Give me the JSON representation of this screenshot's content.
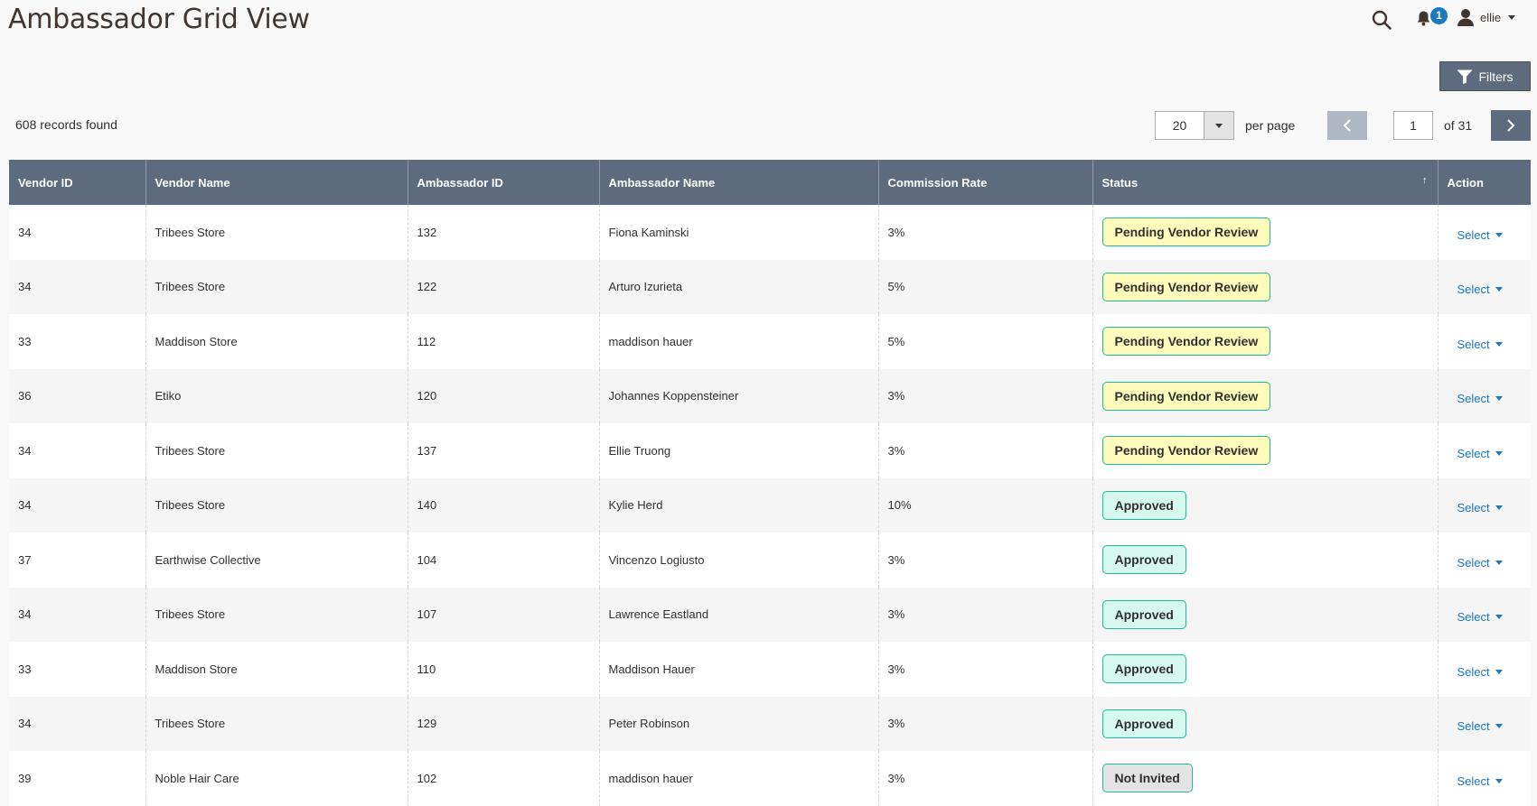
{
  "header": {
    "title": "Ambassador Grid View",
    "notifications_count": "1",
    "user_name": "ellie"
  },
  "toolbar": {
    "filters_label": "Filters",
    "records_found": "608 records found",
    "per_page_value": "20",
    "per_page_label": "per page",
    "current_page": "1",
    "total_pages_label": "of 31"
  },
  "grid": {
    "columns": [
      "Vendor ID",
      "Vendor Name",
      "Ambassador ID",
      "Ambassador Name",
      "Commission Rate",
      "Status",
      "Action"
    ],
    "sort_indicator": "↑",
    "action_label": "Select",
    "rows": [
      {
        "vendor_id": "34",
        "vendor_name": "Tribees Store",
        "ambassador_id": "132",
        "ambassador_name": "Fiona Kaminski",
        "commission_rate": "3%",
        "status": "Pending Vendor Review",
        "status_type": "pending"
      },
      {
        "vendor_id": "34",
        "vendor_name": "Tribees Store",
        "ambassador_id": "122",
        "ambassador_name": "Arturo Izurieta",
        "commission_rate": "5%",
        "status": "Pending Vendor Review",
        "status_type": "pending"
      },
      {
        "vendor_id": "33",
        "vendor_name": "Maddison Store",
        "ambassador_id": "112",
        "ambassador_name": "maddison hauer",
        "commission_rate": "5%",
        "status": "Pending Vendor Review",
        "status_type": "pending"
      },
      {
        "vendor_id": "36",
        "vendor_name": "Etiko",
        "ambassador_id": "120",
        "ambassador_name": "Johannes Koppensteiner",
        "commission_rate": "3%",
        "status": "Pending Vendor Review",
        "status_type": "pending"
      },
      {
        "vendor_id": "34",
        "vendor_name": "Tribees Store",
        "ambassador_id": "137",
        "ambassador_name": "Ellie Truong",
        "commission_rate": "3%",
        "status": "Pending Vendor Review",
        "status_type": "pending"
      },
      {
        "vendor_id": "34",
        "vendor_name": "Tribees Store",
        "ambassador_id": "140",
        "ambassador_name": "Kylie Herd",
        "commission_rate": "10%",
        "status": "Approved",
        "status_type": "approved"
      },
      {
        "vendor_id": "37",
        "vendor_name": "Earthwise Collective",
        "ambassador_id": "104",
        "ambassador_name": "Vincenzo Logiusto",
        "commission_rate": "3%",
        "status": "Approved",
        "status_type": "approved"
      },
      {
        "vendor_id": "34",
        "vendor_name": "Tribees Store",
        "ambassador_id": "107",
        "ambassador_name": "Lawrence Eastland",
        "commission_rate": "3%",
        "status": "Approved",
        "status_type": "approved"
      },
      {
        "vendor_id": "33",
        "vendor_name": "Maddison Store",
        "ambassador_id": "110",
        "ambassador_name": "Maddison Hauer",
        "commission_rate": "3%",
        "status": "Approved",
        "status_type": "approved"
      },
      {
        "vendor_id": "34",
        "vendor_name": "Tribees Store",
        "ambassador_id": "129",
        "ambassador_name": "Peter Robinson",
        "commission_rate": "3%",
        "status": "Approved",
        "status_type": "approved"
      },
      {
        "vendor_id": "39",
        "vendor_name": "Noble Hair Care",
        "ambassador_id": "102",
        "ambassador_name": "maddison hauer",
        "commission_rate": "3%",
        "status": "Not Invited",
        "status_type": "notinvited"
      }
    ]
  },
  "colors": {
    "header_bg": "#5c6c7e",
    "link": "#1979c3",
    "pending_bg": "#fffbbb",
    "approved_bg": "#d7f8ef",
    "notinvited_bg": "#e3e3e3",
    "badge_border": "#1abc9c"
  },
  "icons": [
    "search-icon",
    "bell-icon",
    "user-icon",
    "filter-icon",
    "chevron-left-icon",
    "chevron-right-icon",
    "caret-down-icon"
  ]
}
